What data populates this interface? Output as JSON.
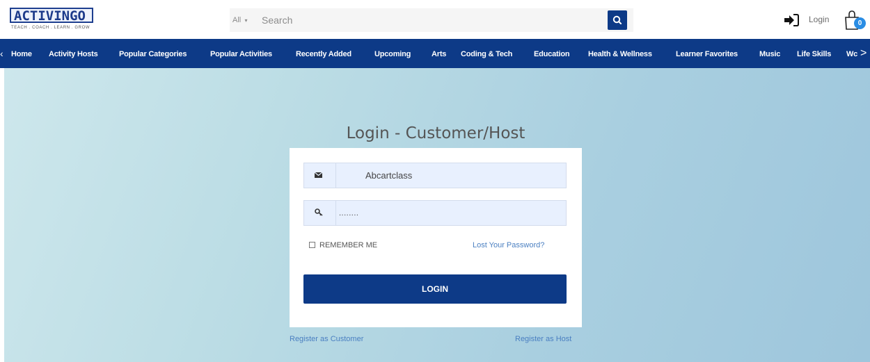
{
  "brand": {
    "logo_text": "ACTIVINGO",
    "tagline": "TEACH . COACH . LEARN . GROW"
  },
  "search": {
    "category": "All",
    "placeholder": "Search"
  },
  "header": {
    "login_label": "Login",
    "cart_count": "0"
  },
  "nav": {
    "items": [
      {
        "label": "Home"
      },
      {
        "label": "Activity Hosts"
      },
      {
        "label": "Popular Categories"
      },
      {
        "label": "Popular Activities"
      },
      {
        "label": "Recently Added"
      },
      {
        "label": "Upcoming"
      },
      {
        "label": "Arts"
      },
      {
        "label": "Coding & Tech"
      },
      {
        "label": "Education"
      },
      {
        "label": "Health & Wellness"
      },
      {
        "label": "Learner Favorites"
      },
      {
        "label": "Music"
      },
      {
        "label": "Life Skills"
      },
      {
        "label": "Wc"
      }
    ],
    "right_arrow": ">"
  },
  "form": {
    "title": "Login - Customer/Host",
    "username_value": "Abcartclass",
    "password_value": "........",
    "remember_label": "REMEMBER ME",
    "lost_password": "Lost Your Password?",
    "login_button": "LOGIN"
  },
  "footer_links": {
    "register_customer": "Register as Customer",
    "register_host": "Register as Host"
  },
  "colors": {
    "primary": "#0d3a87",
    "link": "#4a7fc1",
    "badge": "#2a8de4"
  }
}
